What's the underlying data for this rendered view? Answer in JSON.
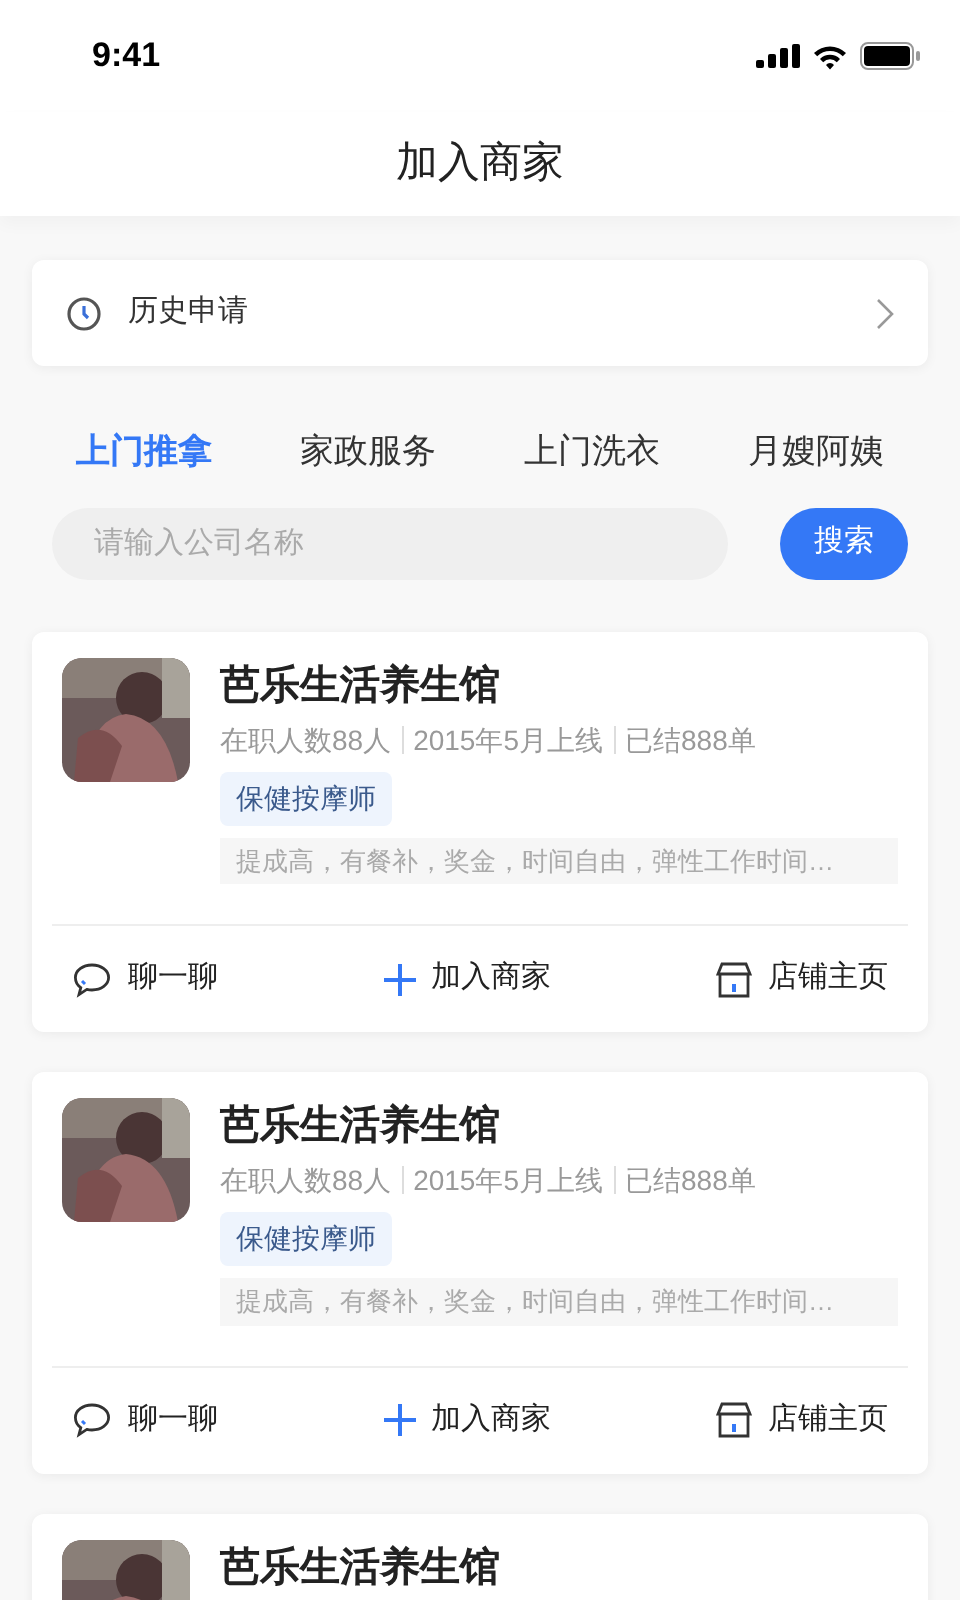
{
  "status_bar": {
    "time": "9:41"
  },
  "header": {
    "title": "加入商家"
  },
  "history": {
    "label": "历史申请"
  },
  "tabs": [
    {
      "label": "上门推拿",
      "selected": true
    },
    {
      "label": "家政服务",
      "selected": false
    },
    {
      "label": "上门洗衣",
      "selected": false
    },
    {
      "label": "月嫂阿姨",
      "selected": false
    }
  ],
  "search": {
    "placeholder": "请输入公司名称",
    "button": "搜索"
  },
  "merchants": [
    {
      "name": "芭乐生活养生馆",
      "meta": [
        "在职人数88人",
        "2015年5月上线",
        "已结888单"
      ],
      "tag": "保健按摩师",
      "description": "提成高，有餐补，奖金，时间自由，弹性工作时间…",
      "actions": [
        "聊一聊",
        "加入商家",
        "店铺主页"
      ]
    },
    {
      "name": "芭乐生活养生馆",
      "meta": [
        "在职人数88人",
        "2015年5月上线",
        "已结888单"
      ],
      "tag": "保健按摩师",
      "description": "提成高，有餐补，奖金，时间自由，弹性工作时间…",
      "actions": [
        "聊一聊",
        "加入商家",
        "店铺主页"
      ]
    },
    {
      "name": "芭乐生活养生馆"
    }
  ]
}
